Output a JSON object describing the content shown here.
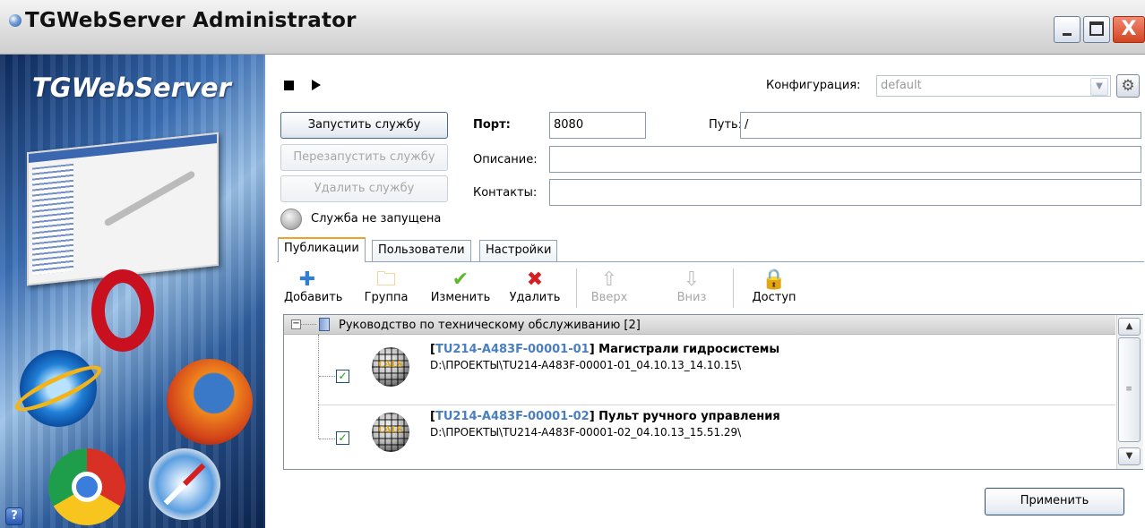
{
  "window": {
    "title": "TGWebServer Administrator",
    "close_glyph": "X"
  },
  "banner": {
    "title": "TGWebServer"
  },
  "help": {
    "glyph": "?"
  },
  "config": {
    "label": "Конфигурация:",
    "value": "default"
  },
  "service": {
    "start_label": "Запустить службу",
    "restart_label": "Перезапустить службу",
    "delete_label": "Удалить службу",
    "status_text": "Служба не запущена"
  },
  "form": {
    "port_label": "Порт:",
    "port_value": "8080",
    "path_label": "Путь:",
    "path_value": "/",
    "description_label": "Описание:",
    "description_value": "",
    "contacts_label": "Контакты:",
    "contacts_value": ""
  },
  "tabs": [
    {
      "label": "Публикации"
    },
    {
      "label": "Пользователи"
    },
    {
      "label": "Настройки"
    }
  ],
  "toolbar": {
    "add": "Добавить",
    "group": "Группа",
    "edit": "Изменить",
    "delete": "Удалить",
    "up": "Вверх",
    "down": "Вниз",
    "access": "Доступ"
  },
  "tree": {
    "root_label": "Руководство по техническому обслуживанию [2]",
    "items": [
      {
        "code": "TU214-A483F-00001-01",
        "title": "Магистрали гидросистемы",
        "path": "D:\\ПРОЕКТЫ\\TU214-A483F-00001-01_04.10.13_14.10.15\\",
        "checked": true,
        "icon_text": "CALS"
      },
      {
        "code": "TU214-A483F-00001-02",
        "title": "Пульт ручного управления",
        "path": "D:\\ПРОЕКТЫ\\TU214-A483F-00001-02_04.10.13_15.51.29\\",
        "checked": true,
        "icon_text": "CALS"
      }
    ]
  },
  "apply_label": "Применить",
  "colors": {
    "accent_tab": "#f0a02b",
    "link_code": "#4a7fbf",
    "close_button": "#d24420"
  }
}
